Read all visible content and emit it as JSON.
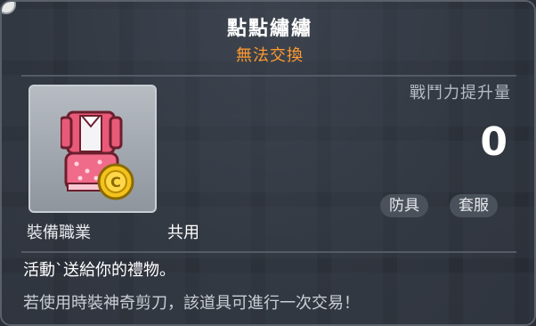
{
  "item": {
    "name": "點點繡繡",
    "trade_status": "無法交換",
    "icon_name": "pink-outfit-with-coin-icon"
  },
  "stats": {
    "power_label": "戰鬥力提升量",
    "power_value": "0"
  },
  "tags": [
    "防具",
    "套服"
  ],
  "requirement": {
    "label": "裝備職業",
    "value": "共用"
  },
  "description": {
    "line1": "活動`送給你的禮物。",
    "line2": "若使用時裝神奇剪刀，該道具可進行一次交易！"
  },
  "colors": {
    "title": "#ffffff",
    "trade_status": "#ff9a2e",
    "background": "#2b3039"
  }
}
